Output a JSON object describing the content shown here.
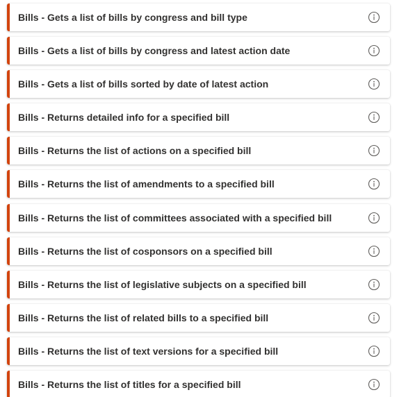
{
  "accent_color": "#d2440e",
  "items": [
    {
      "label": "Bills - Gets a list of bills by congress and bill type",
      "icon": "info-icon"
    },
    {
      "label": "Bills - Gets a list of bills by congress and latest action date",
      "icon": "info-icon"
    },
    {
      "label": "Bills - Gets a list of bills sorted by date of latest action",
      "icon": "info-icon"
    },
    {
      "label": "Bills - Returns detailed info for a specified bill",
      "icon": "info-icon"
    },
    {
      "label": "Bills - Returns the list of actions on a specified bill",
      "icon": "info-icon"
    },
    {
      "label": "Bills - Returns the list of amendments to a specified bill",
      "icon": "info-icon"
    },
    {
      "label": "Bills - Returns the list of committees associated with a specified bill",
      "icon": "info-icon"
    },
    {
      "label": "Bills - Returns the list of cosponsors on a specified bill",
      "icon": "info-icon"
    },
    {
      "label": "Bills - Returns the list of legislative subjects on a specified bill",
      "icon": "info-icon"
    },
    {
      "label": "Bills - Returns the list of related bills to a specified bill",
      "icon": "info-icon"
    },
    {
      "label": "Bills - Returns the list of text versions for a specified bill",
      "icon": "info-icon"
    },
    {
      "label": "Bills - Returns the list of titles for a specified bill",
      "icon": "info-icon"
    }
  ]
}
